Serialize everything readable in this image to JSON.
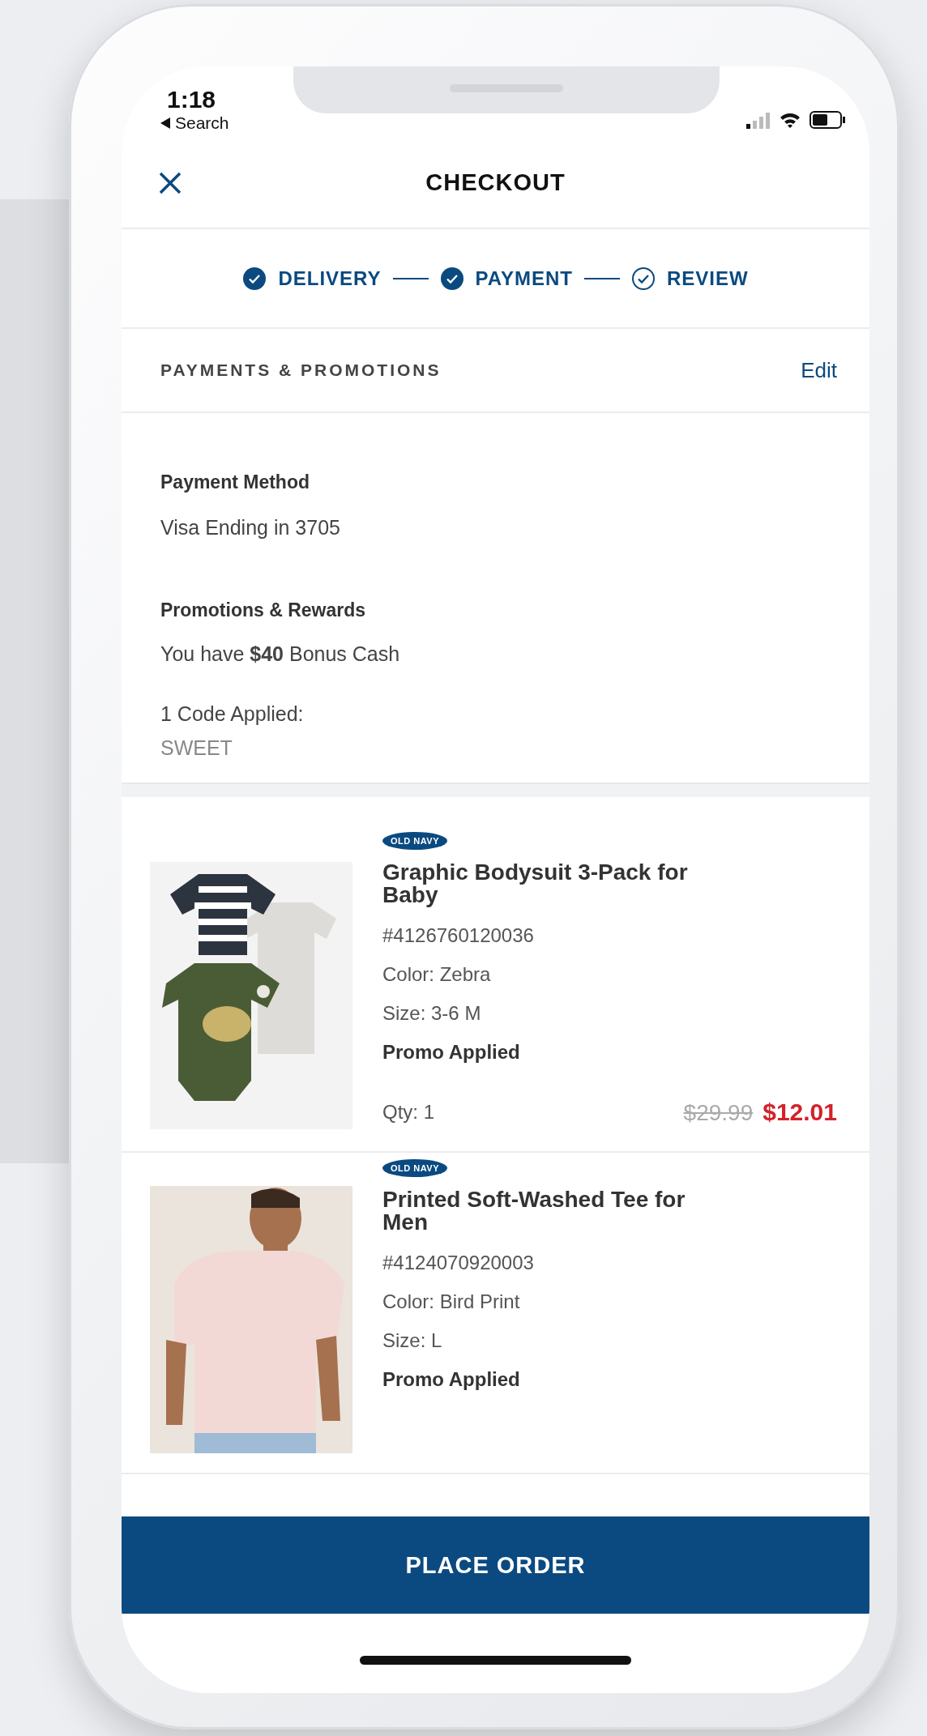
{
  "status_bar": {
    "time": "1:18",
    "back_label": "Search"
  },
  "header": {
    "title": "CHECKOUT"
  },
  "steps": [
    {
      "label": "DELIVERY",
      "completed": true
    },
    {
      "label": "PAYMENT",
      "completed": true
    },
    {
      "label": "REVIEW",
      "completed": false
    }
  ],
  "section": {
    "title": "PAYMENTS & PROMOTIONS",
    "action": "Edit"
  },
  "payment": {
    "label": "Payment Method",
    "value": "Visa Ending in 3705"
  },
  "promotions": {
    "label": "Promotions & Rewards",
    "bonus": "You have **$40** Bonus Cash",
    "codes_label": "1 Code Applied:",
    "code": "SWEET"
  },
  "items": [
    {
      "brand": "OLD NAVY",
      "name": "Graphic Bodysuit 3-Pack for Baby",
      "sku": "#4126760120036",
      "color_label": "Color: Zebra",
      "size": "Size: 3-6 M",
      "promo": "Promo Applied",
      "qty": "Qty: 1",
      "original_price": "$29.99",
      "price": "$12.01"
    },
    {
      "brand": "OLD NAVY",
      "name": "Printed Soft-Washed Tee for Men",
      "sku": "#4124070920003",
      "color_label": "Color: Bird Print",
      "size": "Size: L",
      "promo": "Promo Applied"
    }
  ],
  "button": "PLACE ORDER"
}
